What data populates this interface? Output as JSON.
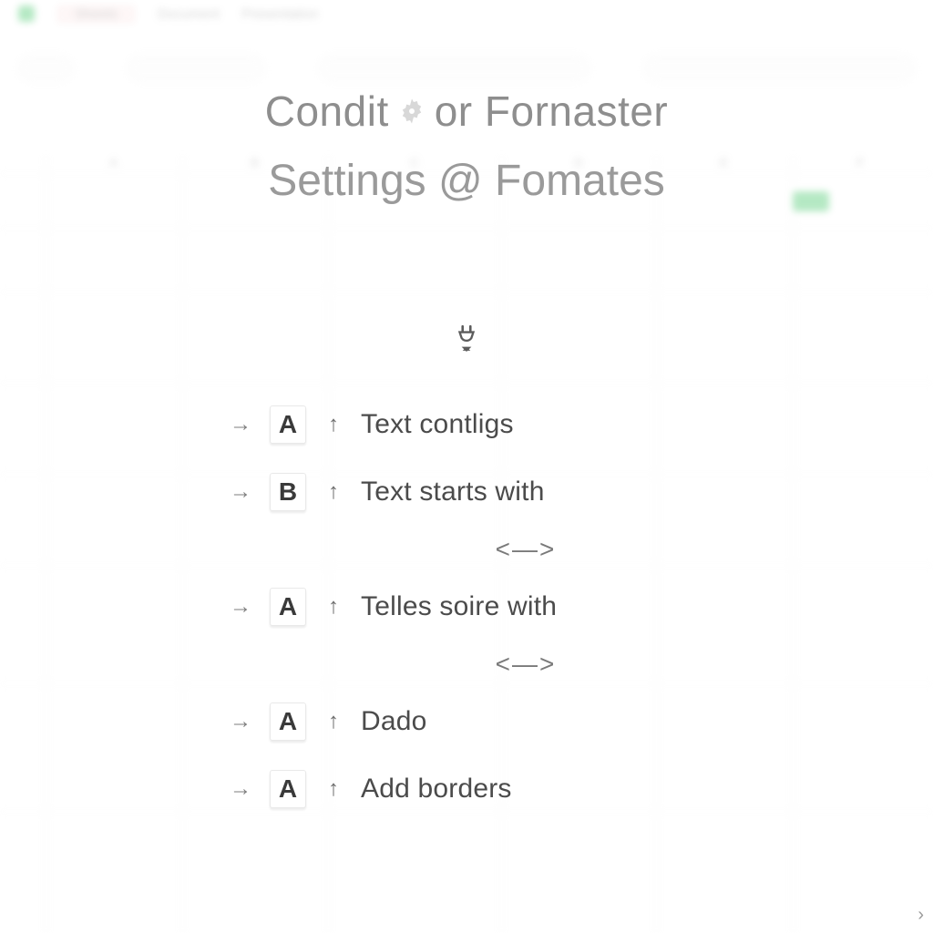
{
  "background": {
    "toolbar": {
      "tab_active": "Sheets",
      "tab2": "Document",
      "tab3": "Presentation"
    },
    "columns": [
      "A",
      "B",
      "C",
      "D",
      "E",
      "F",
      "G"
    ]
  },
  "header": {
    "title_prefix": "Condit",
    "title_suffix": "or Fornaster",
    "subtitle": "Settings @ Fomates"
  },
  "icons": {
    "top": "plug-down",
    "separator_glyph": "<—>"
  },
  "rules": [
    {
      "badge": "A",
      "label": "Text contligs"
    },
    {
      "badge": "B",
      "label": "Text starts with"
    },
    {
      "badge": "A",
      "label": "Telles soire with"
    },
    {
      "badge": "A",
      "label": "Dado"
    },
    {
      "badge": "A",
      "label": "Add borders"
    }
  ]
}
